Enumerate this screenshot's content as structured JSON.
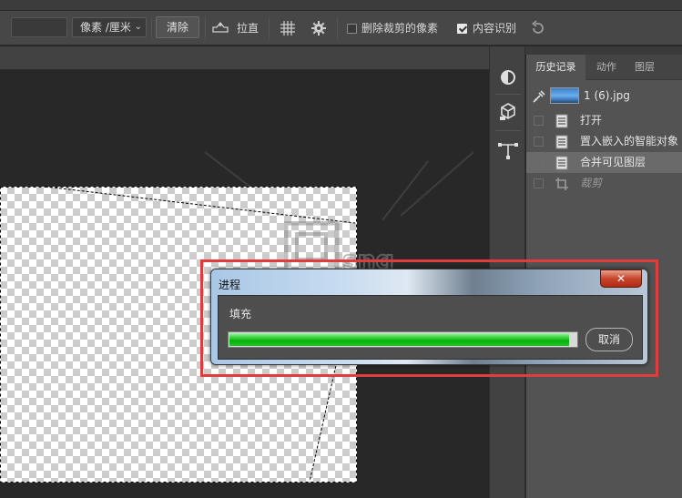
{
  "options_bar": {
    "unit_select": "像素 /厘米",
    "clear_button": "清除",
    "straighten_label": "拉直",
    "delete_cropped_label": "删除裁剪的像素",
    "delete_cropped_checked": false,
    "content_aware_label": "内容识别",
    "content_aware_checked": true
  },
  "panel": {
    "tabs": [
      "历史记录",
      "动作",
      "图层"
    ],
    "active_tab": 0,
    "snapshot_label": "1 (6).jpg",
    "history": [
      {
        "label": "打开",
        "icon": "document-icon",
        "state": "normal"
      },
      {
        "label": "置入嵌入的智能对象",
        "icon": "document-icon",
        "state": "normal"
      },
      {
        "label": "合并可见图层",
        "icon": "document-icon",
        "state": "selected"
      },
      {
        "label": "裁剪",
        "icon": "crop-icon",
        "state": "dimmed"
      }
    ]
  },
  "dialog": {
    "title": "进程",
    "close_label": "✕",
    "message": "填充",
    "progress": 0.98,
    "cancel_label": "取消"
  },
  "colors": {
    "highlight": "#e03c3c",
    "progress_green": "#06b00c"
  }
}
